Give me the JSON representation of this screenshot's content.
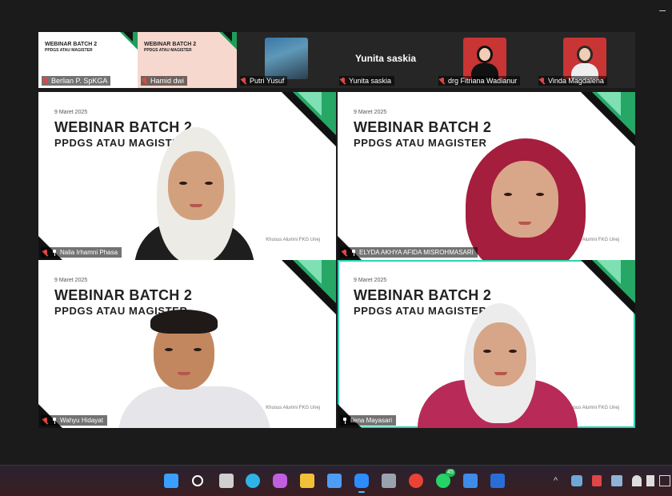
{
  "window": {
    "minimize_glyph": "–"
  },
  "filmstrip": {
    "tiles": [
      {
        "name": "Berlian P. SpKGA",
        "slide_title": "WEBINAR BATCH 2",
        "slide_sub": "PPDGS ATAU MAGISTER",
        "mic_muted": true
      },
      {
        "name": "Hamid dwi",
        "slide_title": "WEBINAR BATCH 2",
        "slide_sub": "PPDGS ATAU MAGISTER",
        "mic_muted": true
      },
      {
        "name": "Putri Yusuf",
        "mic_muted": true
      },
      {
        "name": "Yunita saskia",
        "display_name": "Yunita saskia",
        "mic_muted": true
      },
      {
        "name": "drg Fitriana Wadianur",
        "mic_muted": true
      },
      {
        "name": "Vinda Magdalena",
        "mic_muted": true
      }
    ]
  },
  "grid": {
    "tiles": [
      {
        "name": "Nalia Irhamni Phasa",
        "date": "9 Maret 2025",
        "title1": "WEBINAR BATCH 2",
        "title2": "PPDGS ATAU MAGISTER",
        "footer": "Khusus Alumni FKG Unej",
        "mic_muted": true,
        "pinned": true
      },
      {
        "name": "ELYDA AKHYA AFIDA MISROHMASARI",
        "date": "9 Maret 2025",
        "title1": "WEBINAR BATCH 2",
        "title2": "PPDGS ATAU MAGISTER",
        "footer": "Khusus Alumni FKG Unej",
        "mic_muted": true,
        "pinned": true
      },
      {
        "name": "Wahyu Hidayat",
        "date": "9 Maret 2025",
        "title1": "WEBINAR BATCH 2",
        "title2": "PPDGS ATAU MAGISTER",
        "footer": "Khusus Alumni FKG Unej",
        "mic_muted": true,
        "pinned": true
      },
      {
        "name": "Ilena Mayasari",
        "date": "9 Maret 2025",
        "title1": "WEBINAR BATCH 2",
        "title2": "PPDGS ATAU MAGISTER",
        "footer": "Khusus Alumni FKG Unej",
        "mic_muted": false,
        "pinned": true,
        "active_speaker": true
      }
    ]
  },
  "taskbar": {
    "icons": [
      {
        "name": "windows-start-icon",
        "color": "#3aa0ff"
      },
      {
        "name": "search-icon",
        "color": "#ffffff"
      },
      {
        "name": "task-view-icon",
        "color": "#cfcfcf"
      },
      {
        "name": "edge-icon",
        "color": "#2db3e8"
      },
      {
        "name": "copilot-icon",
        "color": "#c25ee0"
      },
      {
        "name": "file-explorer-icon",
        "color": "#f2c037"
      },
      {
        "name": "microsoft-store-icon",
        "color": "#4f9cf5"
      },
      {
        "name": "zoom-icon",
        "color": "#2d8cff",
        "active": true
      },
      {
        "name": "camera-icon",
        "color": "#9aa3ad"
      },
      {
        "name": "chrome-icon",
        "color": "#e94335"
      },
      {
        "name": "whatsapp-icon",
        "color": "#25d366",
        "badge": "45"
      },
      {
        "name": "snipping-tool-icon",
        "color": "#3f8be8"
      },
      {
        "name": "word-icon",
        "color": "#2b6dd6"
      }
    ],
    "tray": {
      "chevron": "^"
    }
  }
}
